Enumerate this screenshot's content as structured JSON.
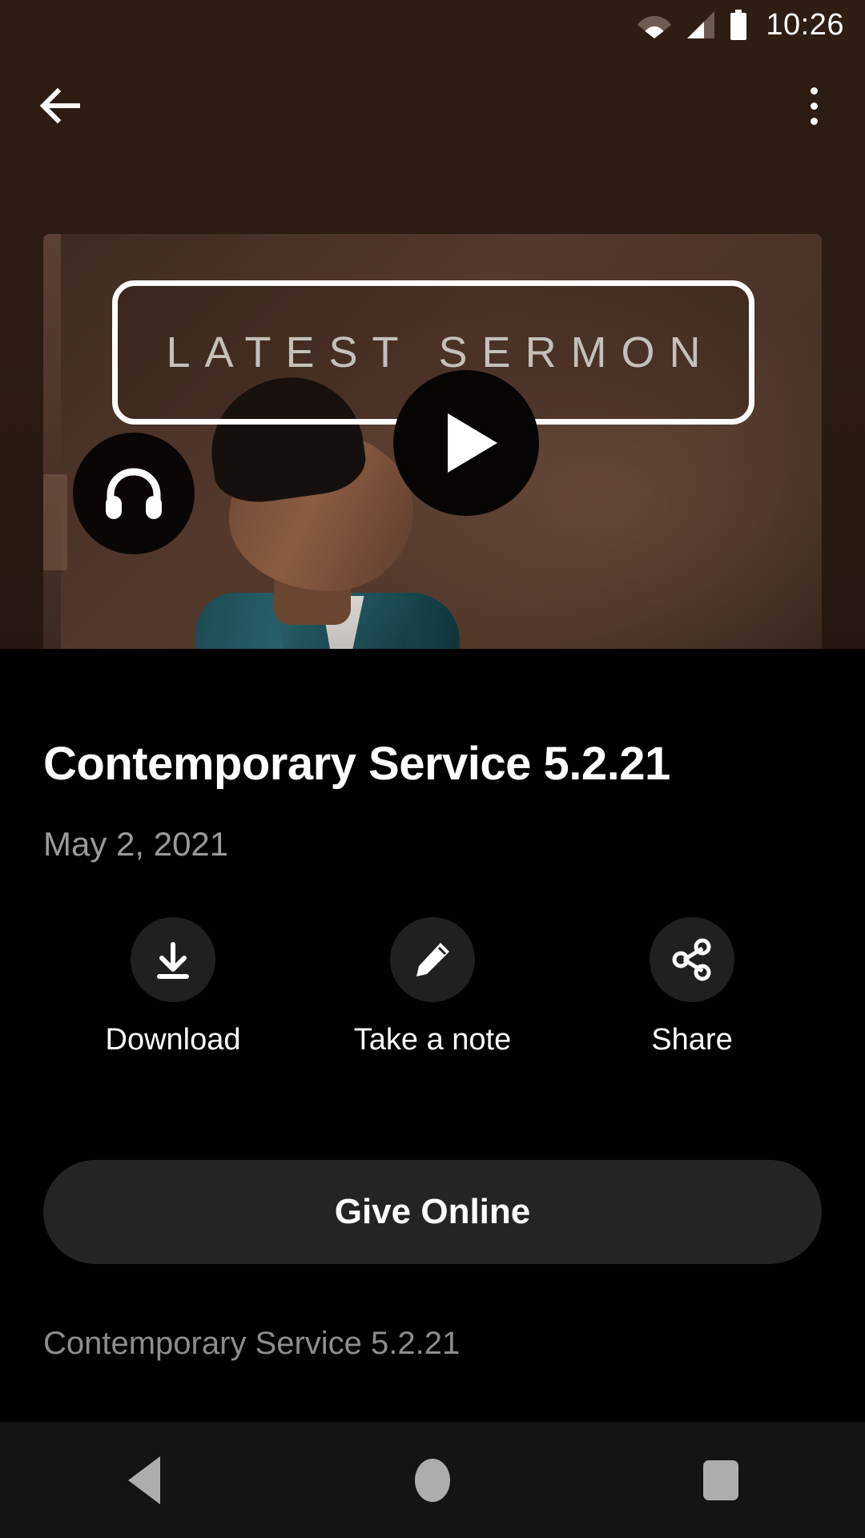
{
  "status_bar": {
    "time": "10:26",
    "icons": [
      "wifi-icon",
      "cellular-signal-icon",
      "battery-icon"
    ]
  },
  "toolbar": {
    "back_icon": "back-arrow-icon",
    "overflow_icon": "more-vertical-icon"
  },
  "video": {
    "overlay_title": "LATEST SERMON",
    "play_icon": "play-icon",
    "audio_icon": "headphones-icon"
  },
  "sermon": {
    "title": "Contemporary Service 5.2.21",
    "date": "May 2, 2021",
    "description": "Contemporary Service 5.2.21"
  },
  "actions": [
    {
      "label": "Download",
      "icon": "download-icon"
    },
    {
      "label": "Take a note",
      "icon": "pencil-icon"
    },
    {
      "label": "Share",
      "icon": "share-icon"
    }
  ],
  "give_button": {
    "label": "Give Online"
  },
  "nav_bar": {
    "back": "navigation-back-icon",
    "home": "navigation-home-icon",
    "recents": "navigation-recents-icon"
  },
  "colors": {
    "app_bar_brown": "#2b1b11",
    "page_background": "#000000",
    "surface_gray": "#202020",
    "give_button_gray": "#242424",
    "primary_text": "#ffffff",
    "secondary_text": "#9a9a9a",
    "nav_bar_background": "#141414",
    "nav_icon_gray": "#adadad"
  }
}
